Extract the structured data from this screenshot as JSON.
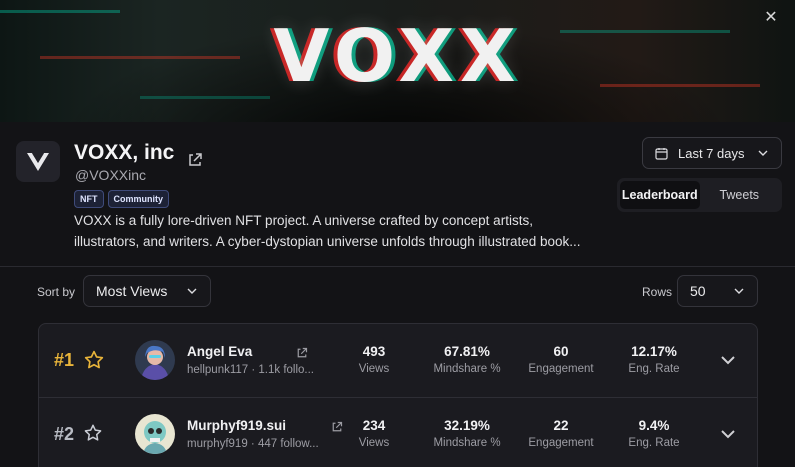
{
  "banner": {
    "title": "VOXX",
    "close_icon": "close-icon"
  },
  "project": {
    "name": "VOXX, inc",
    "handle": "@VOXXinc",
    "tags": [
      "NFT",
      "Community"
    ],
    "description_line1": "VOXX is a fully lore-driven NFT project. A universe crafted by concept artists,",
    "description_line2": "illustrators, and writers. A cyber-dystopian universe unfolds through illustrated book..."
  },
  "controls": {
    "date_range": "Last 7 days",
    "tabs": [
      {
        "label": "Leaderboard",
        "active": true
      },
      {
        "label": "Tweets",
        "active": false
      }
    ],
    "sort_label": "Sort by",
    "sort_value": "Most Views",
    "rows_label": "Rows",
    "rows_value": "50"
  },
  "leaderboard": [
    {
      "rank": "#1",
      "rank_color": "#e8b43a",
      "starred_style": "gold",
      "name": "Angel Eva",
      "sub": "hellpunk117 · 1.1k follo...",
      "views": "493",
      "views_label": "Views",
      "mindshare": "67.81%",
      "mindshare_label": "Mindshare %",
      "engagement": "60",
      "engagement_label": "Engagement",
      "eng_rate": "12.17%",
      "eng_rate_label": "Eng. Rate"
    },
    {
      "rank": "#2",
      "rank_color": "#b9bcc4",
      "starred_style": "silver",
      "name": "Murphyf919.sui",
      "sub": "murphyf919 · 447 follow...",
      "views": "234",
      "views_label": "Views",
      "mindshare": "32.19%",
      "mindshare_label": "Mindshare %",
      "engagement": "22",
      "engagement_label": "Engagement",
      "eng_rate": "9.4%",
      "eng_rate_label": "Eng. Rate"
    }
  ],
  "colors": {
    "background": "#131316",
    "card": "#1b1b20",
    "gold": "#e8b43a",
    "tag_border": "#3f4b7a"
  }
}
